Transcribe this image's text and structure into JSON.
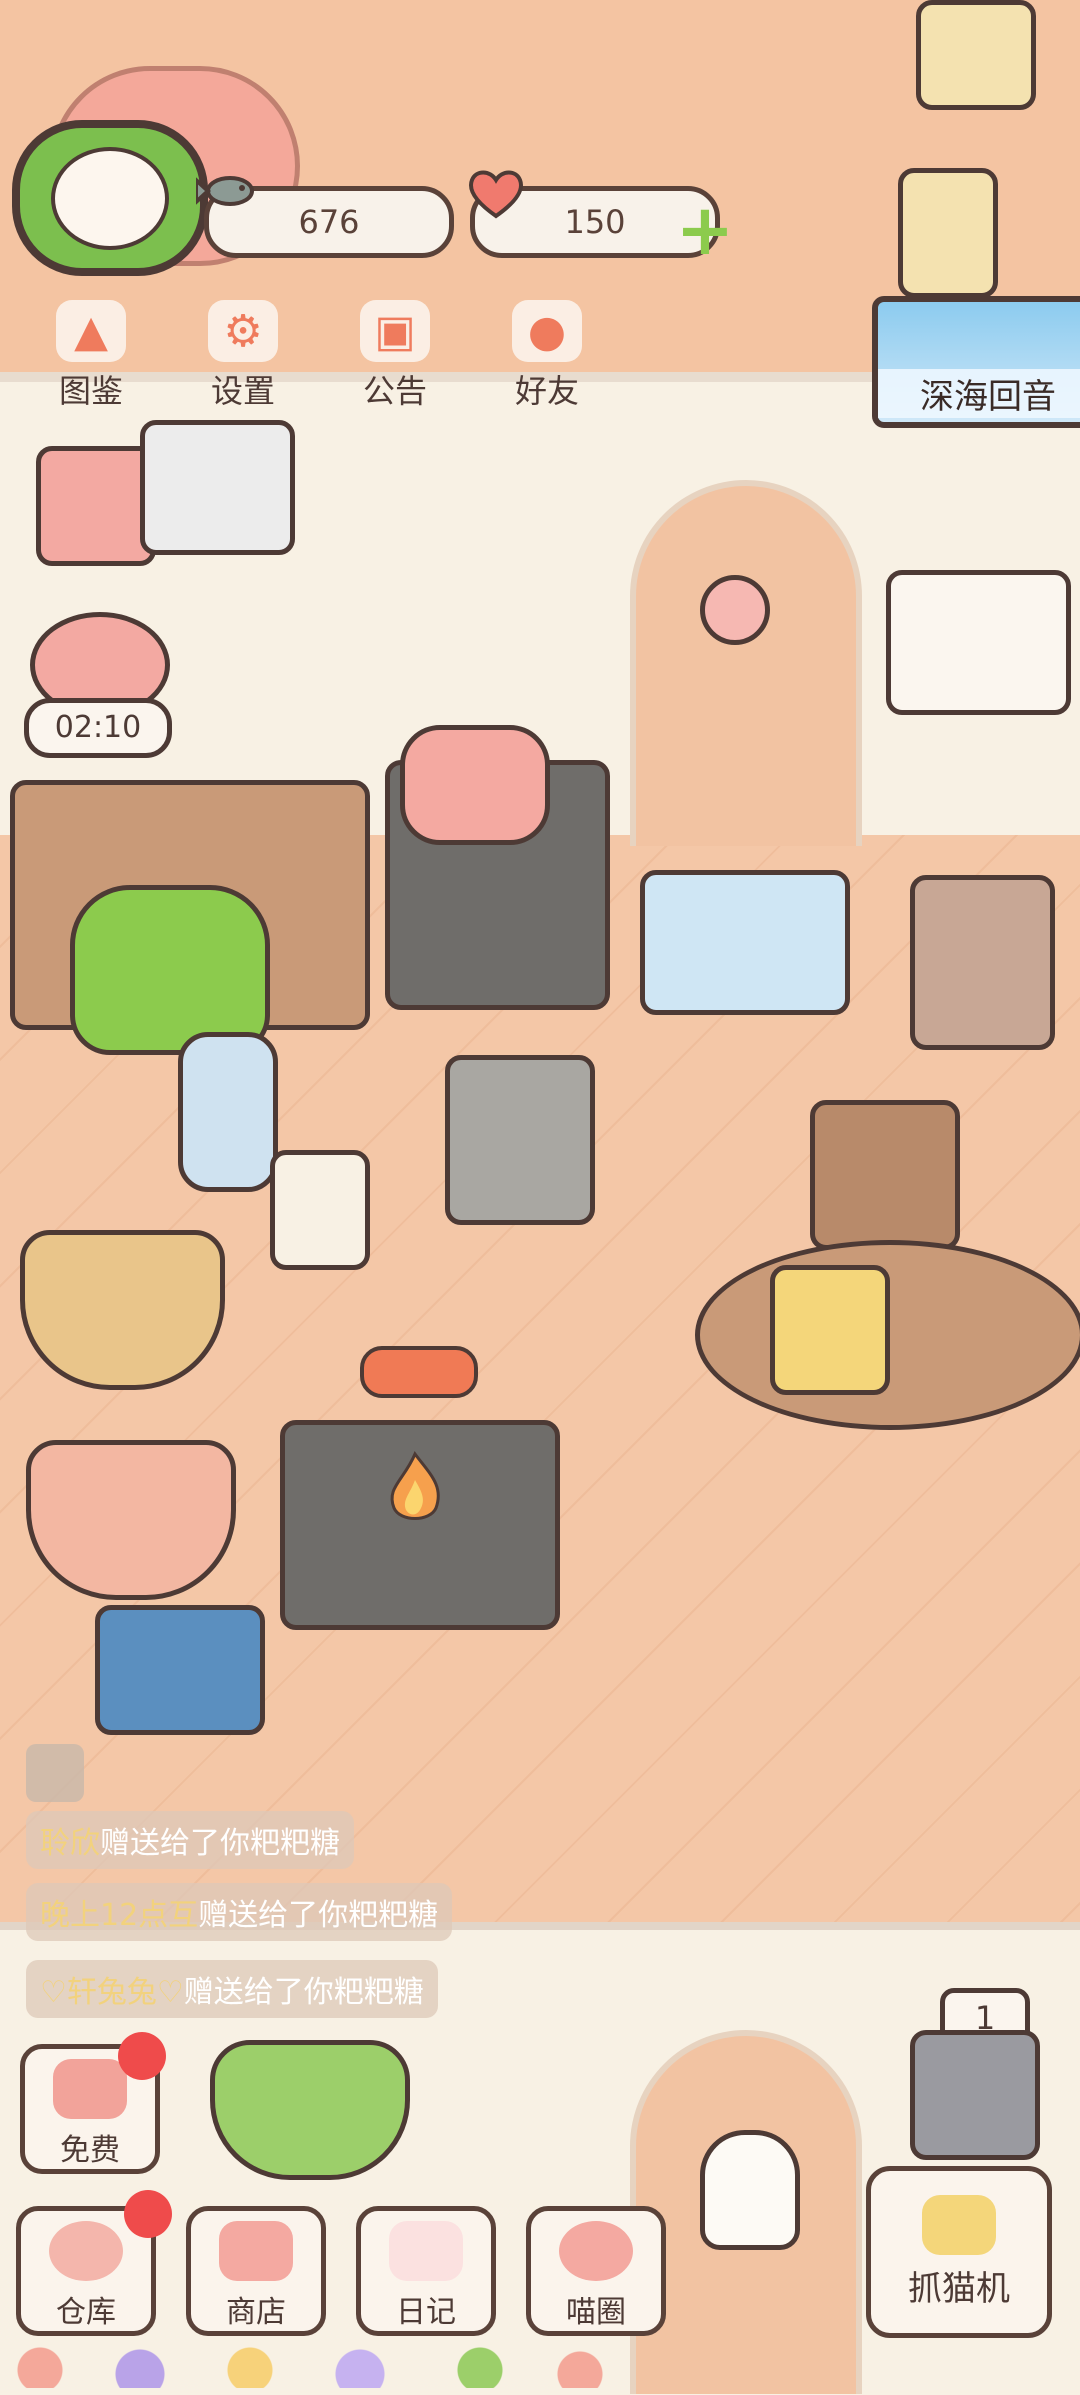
{
  "resources": {
    "fish_count": "676",
    "heart_count": "150"
  },
  "top_menu": [
    {
      "label": "图鉴",
      "icon": "cat-book-icon"
    },
    {
      "label": "设置",
      "icon": "gear-icon"
    },
    {
      "label": "公告",
      "icon": "gift-icon"
    },
    {
      "label": "好友",
      "icon": "friends-icon"
    }
  ],
  "event_banner": {
    "label": "深海回音"
  },
  "cooking_timer": "02:10",
  "chat": {
    "messages": [
      {
        "name": "聆欣",
        "text": "赠送给了你粑粑糖"
      },
      {
        "name": "晚上12点互",
        "text": "赠送给了你粑粑糖"
      },
      {
        "name": "♡轩兔兔♡",
        "text": "赠送给了你粑粑糖"
      }
    ]
  },
  "free_button": {
    "label": "免费"
  },
  "bottom_nav": [
    {
      "label": "仓库",
      "badge": true
    },
    {
      "label": "商店",
      "badge": false
    },
    {
      "label": "日记",
      "badge": false
    },
    {
      "label": "喵圈",
      "badge": false
    }
  ],
  "claw_machine": {
    "label": "抓猫机",
    "count": "1"
  },
  "colors": {
    "accent": "#ef7b5d",
    "outline": "#4d3a35",
    "badge": "#ef4b4b",
    "plus": "#8ccb4d",
    "chat_name": "#f2d27d"
  }
}
